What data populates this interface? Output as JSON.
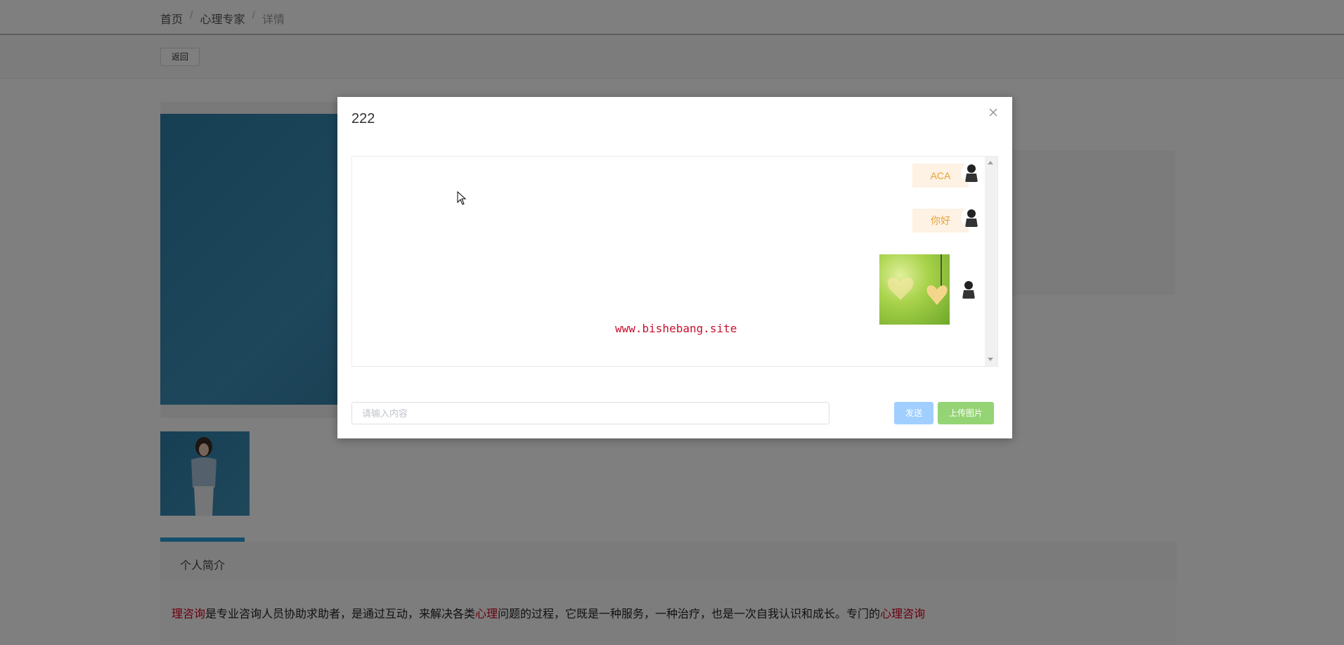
{
  "breadcrumb": {
    "home": "首页",
    "section": "心理专家",
    "current": "详情",
    "separator": "/"
  },
  "toolbar": {
    "back_label": "返回"
  },
  "tabs": [
    {
      "label": "个人简介"
    }
  ],
  "intro": {
    "part1": "理咨询",
    "part2": "是专业咨询人员协助求助者，是通过互动，来解决各类",
    "part3": "心理",
    "part4": "问题的过程，它既是一种服务，一种治疗，也是一次自我认识和成长。专门的",
    "part5": "心理咨询"
  },
  "modal": {
    "title": "222",
    "close_icon": "close-icon",
    "messages": [
      {
        "type": "text",
        "text": "ACA"
      },
      {
        "type": "text",
        "text": "你好"
      },
      {
        "type": "image",
        "image": "heart-image"
      }
    ],
    "watermark": "www.bishebang.site",
    "input_placeholder": "请输入内容",
    "input_value": "",
    "send_label": "发送",
    "upload_label": "上传图片"
  },
  "colors": {
    "bubble_bg": "#fdf2e3",
    "bubble_text": "#e6a23c",
    "send": "#a0cfff",
    "upload": "#95d475",
    "accent": "#2a9fd6"
  }
}
